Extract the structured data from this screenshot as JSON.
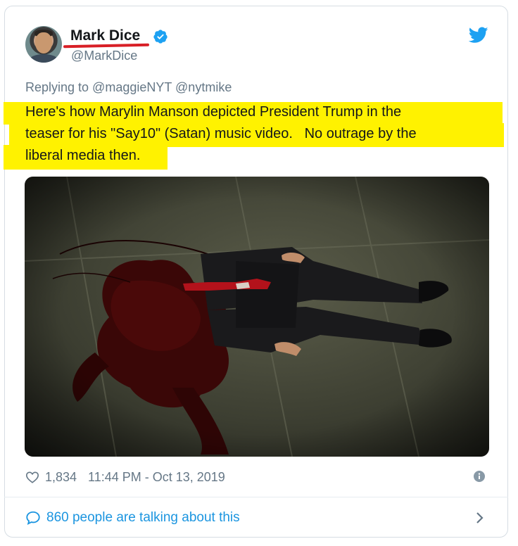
{
  "tweet": {
    "author": {
      "display_name": "Mark Dice",
      "handle": "@MarkDice",
      "verified": true
    },
    "replying_to": "Replying to @maggieNYT @nytmike",
    "text_lines": [
      "Here's how Marylin Manson depicted President Trump in the",
      "teaser for his \"Say10\" (Satan) music video.   No outrage by the",
      "liberal media then."
    ],
    "likes": "1,834",
    "timestamp": "11:44 PM - Oct 13, 2019",
    "talking": "860 people are talking about this"
  },
  "colors": {
    "twitter_blue": "#1da1f2",
    "link_blue": "#1b95e0",
    "highlight": "#fff200",
    "underline_red": "#d81f26",
    "muted_text": "#657786"
  },
  "icons": [
    "avatar",
    "verified-badge-icon",
    "twitter-bird-icon",
    "heart-icon",
    "info-icon",
    "speech-bubble-icon",
    "chevron-right-icon"
  ]
}
